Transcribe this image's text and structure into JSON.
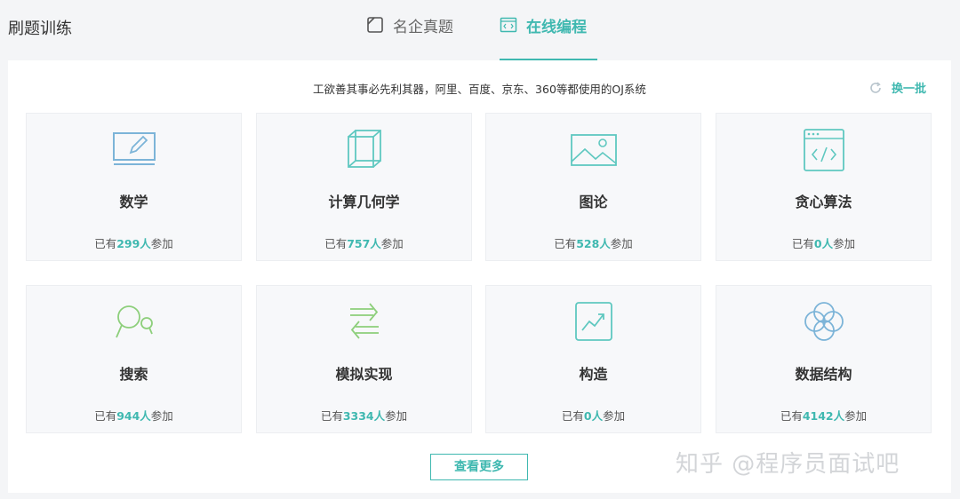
{
  "header": {
    "title": "刷题训练",
    "tabs": [
      {
        "label": "名企真题",
        "icon": "document-icon",
        "active": false
      },
      {
        "label": "在线编程",
        "icon": "code-window-icon",
        "active": true
      }
    ]
  },
  "panel": {
    "slogan": "工欲善其事必先利其器，阿里、百度、京东、360等都使用的OJ系统",
    "refresh_label": "换一批",
    "more_label": "查看更多"
  },
  "cards": [
    {
      "name": "数学",
      "prefix": "已有",
      "count": "299人",
      "suffix": "参加",
      "icon": "pencil-board-icon"
    },
    {
      "name": "计算几何学",
      "prefix": "已有",
      "count": "757人",
      "suffix": "参加",
      "icon": "cube-icon"
    },
    {
      "name": "图论",
      "prefix": "已有",
      "count": "528人",
      "suffix": "参加",
      "icon": "image-icon"
    },
    {
      "name": "贪心算法",
      "prefix": "已有",
      "count": "0人",
      "suffix": "参加",
      "icon": "code-window-icon"
    },
    {
      "name": "搜索",
      "prefix": "已有",
      "count": "944人",
      "suffix": "参加",
      "icon": "magnifier-icon"
    },
    {
      "name": "模拟实现",
      "prefix": "已有",
      "count": "3334人",
      "suffix": "参加",
      "icon": "swap-arrows-icon"
    },
    {
      "name": "构造",
      "prefix": "已有",
      "count": "0人",
      "suffix": "参加",
      "icon": "trend-chart-icon"
    },
    {
      "name": "数据结构",
      "prefix": "已有",
      "count": "4142人",
      "suffix": "参加",
      "icon": "circles-icon"
    }
  ],
  "watermark": "知乎 @程序员面试吧",
  "colors": {
    "accent": "#3fb8b0",
    "icon_blue": "#7cb4d8",
    "icon_green": "#8dcf7b",
    "icon_teal": "#5fc8c0"
  }
}
